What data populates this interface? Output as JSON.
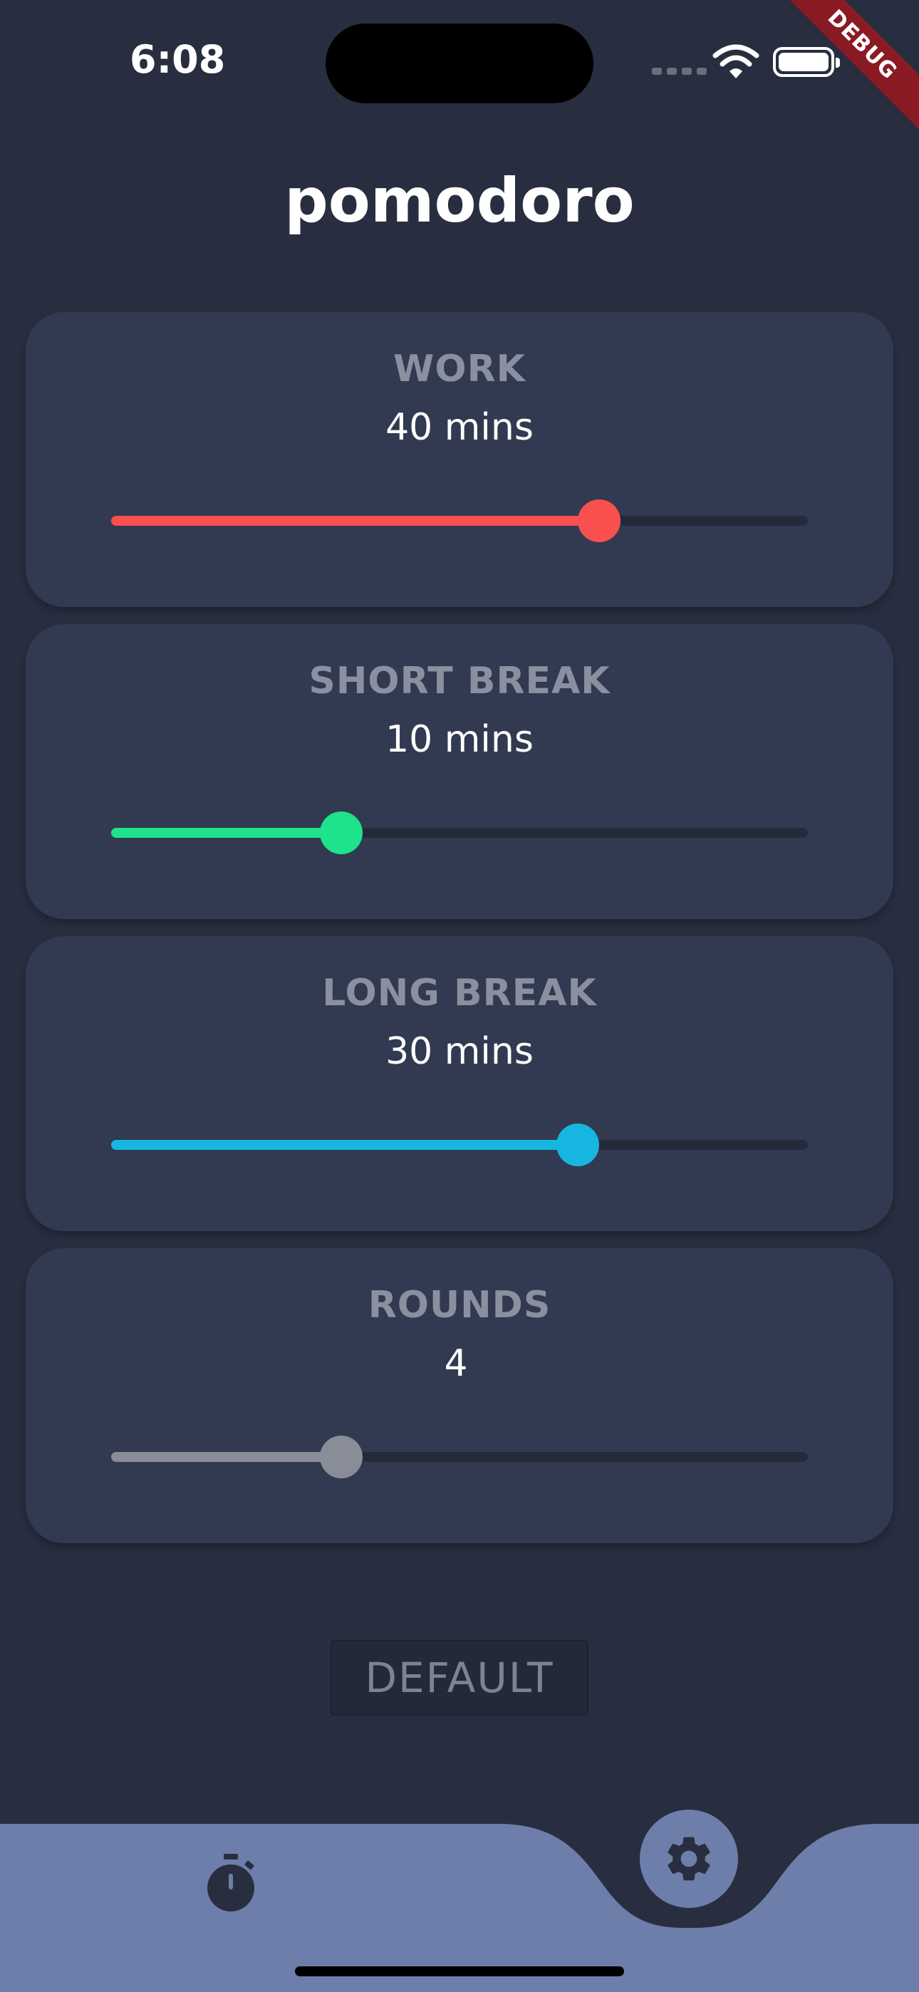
{
  "status_bar": {
    "time": "6:08",
    "debug_label": "DEBUG"
  },
  "app": {
    "title": "pomodoro"
  },
  "settings": [
    {
      "label": "WORK",
      "value_text": "40 mins",
      "level": 0.7,
      "color": "#f94f4f"
    },
    {
      "label": "SHORT BREAK",
      "value_text": "10 mins",
      "level": 0.33,
      "color": "#1ee38a"
    },
    {
      "label": "LONG BREAK",
      "value_text": "30 mins",
      "level": 0.67,
      "color": "#17b6e0"
    },
    {
      "label": "ROUNDS",
      "value_text": "4",
      "level": 0.33,
      "color": "#888d98"
    }
  ],
  "default_button": {
    "label": "DEFAULT"
  },
  "nav": {
    "timer_icon": "timer-icon",
    "settings_icon": "gear-icon",
    "bar_color": "#6e7eaa"
  }
}
